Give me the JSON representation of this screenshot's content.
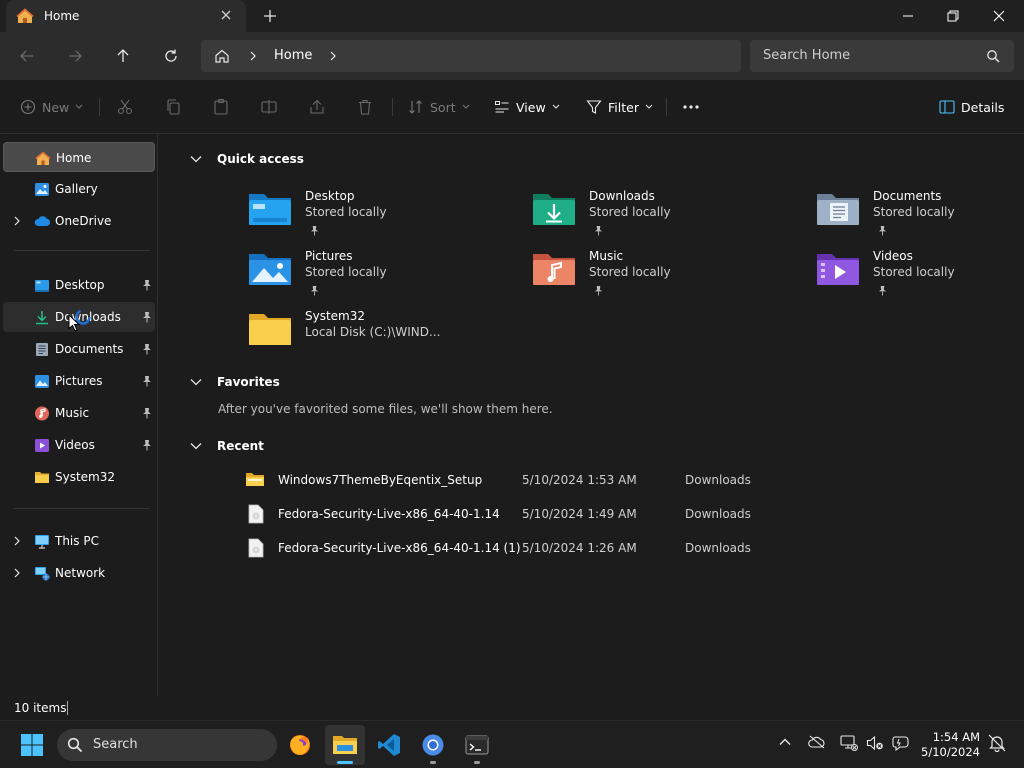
{
  "window": {
    "tab_title": "Home",
    "address": {
      "path": "Home"
    },
    "search_placeholder": "Search Home"
  },
  "commands": {
    "new": "New",
    "sort": "Sort",
    "view": "View",
    "filter": "Filter",
    "details": "Details"
  },
  "sidebar": {
    "top": [
      {
        "label": "Home",
        "icon": "home-icon"
      },
      {
        "label": "Gallery",
        "icon": "gallery-icon"
      },
      {
        "label": "OneDrive",
        "icon": "cloud-icon"
      }
    ],
    "pinned": [
      {
        "label": "Desktop",
        "icon": "desktop-folder-icon"
      },
      {
        "label": "Downloads",
        "icon": "download-icon"
      },
      {
        "label": "Documents",
        "icon": "documents-icon"
      },
      {
        "label": "Pictures",
        "icon": "pictures-icon"
      },
      {
        "label": "Music",
        "icon": "music-icon"
      },
      {
        "label": "Videos",
        "icon": "videos-icon"
      },
      {
        "label": "System32",
        "icon": "folder-icon"
      }
    ],
    "bottom": [
      {
        "label": "This PC",
        "icon": "pc-icon"
      },
      {
        "label": "Network",
        "icon": "network-icon"
      }
    ]
  },
  "quick_access": {
    "title": "Quick access",
    "items": [
      {
        "name": "Desktop",
        "sub": "Stored locally",
        "icon": "desktop-folder-icon",
        "color": "#1e90d8"
      },
      {
        "name": "Downloads",
        "sub": "Stored locally",
        "icon": "downloads-folder-icon",
        "color": "#19a37b"
      },
      {
        "name": "Documents",
        "sub": "Stored locally",
        "icon": "documents-folder-icon",
        "color": "#8aa0b8"
      },
      {
        "name": "Pictures",
        "sub": "Stored locally",
        "icon": "pictures-folder-icon",
        "color": "#2a8fe0"
      },
      {
        "name": "Music",
        "sub": "Stored locally",
        "icon": "music-folder-icon",
        "color": "#e0765a"
      },
      {
        "name": "Videos",
        "sub": "Stored locally",
        "icon": "videos-folder-icon",
        "color": "#8b4fd8"
      },
      {
        "name": "System32",
        "sub": "Local Disk (C:)\\WIND...",
        "icon": "folder-icon",
        "color": "#f5c542"
      }
    ]
  },
  "favorites": {
    "title": "Favorites",
    "empty_message": "After you've favorited some files, we'll show them here."
  },
  "recent": {
    "title": "Recent",
    "rows": [
      {
        "name": "Windows7ThemeByEqentix_Setup",
        "date": "5/10/2024 1:53 AM",
        "location": "Downloads",
        "icon": "folder-icon"
      },
      {
        "name": "Fedora-Security-Live-x86_64-40-1.14",
        "date": "5/10/2024 1:49 AM",
        "location": "Downloads",
        "icon": "disc-file-icon"
      },
      {
        "name": "Fedora-Security-Live-x86_64-40-1.14 (1)",
        "date": "5/10/2024 1:26 AM",
        "location": "Downloads",
        "icon": "disc-file-icon"
      }
    ]
  },
  "status": {
    "item_count": "10 items"
  },
  "taskbar": {
    "search": "Search",
    "time": "1:54 AM",
    "date": "5/10/2024"
  },
  "colors": {
    "accent": "#4cc2ff",
    "folder": "#f5c542"
  }
}
